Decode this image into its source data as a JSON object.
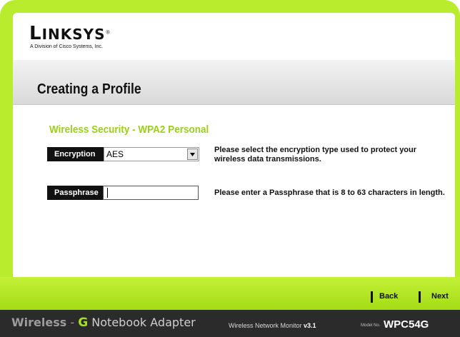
{
  "brand": {
    "logo_first": "L",
    "logo_rest": "INKSYS",
    "logo_mark": "®",
    "tagline": "A Division of Cisco Systems, Inc."
  },
  "header": {
    "title": "Creating a Profile"
  },
  "section": {
    "heading": "Wireless Security - WPA2 Personal"
  },
  "form": {
    "encryption": {
      "label": "Encryption",
      "value": "AES",
      "help": "Please select the encryption type used to protect your wireless data transmissions."
    },
    "passphrase": {
      "label": "Passphrase",
      "value": "",
      "help": "Please enter a Passphrase that is 8 to 63 characters in length."
    }
  },
  "nav": {
    "back_label": "Back",
    "next_label": "Next"
  },
  "footer": {
    "wireless": "Wireless",
    "dash": "-",
    "g": "G",
    "product": "Notebook Adapter",
    "monitor_text": "Wireless Network Monitor",
    "monitor_version": "v3.1",
    "model_label": "Model No.",
    "model": "WPC54G"
  },
  "colors": {
    "accent_green": "#a4dc16",
    "heading_green": "#9bd019",
    "label_black": "#111111",
    "footer_dark": "#2b2b2b"
  },
  "icons": {
    "dropdown": "chevron-down-icon"
  }
}
